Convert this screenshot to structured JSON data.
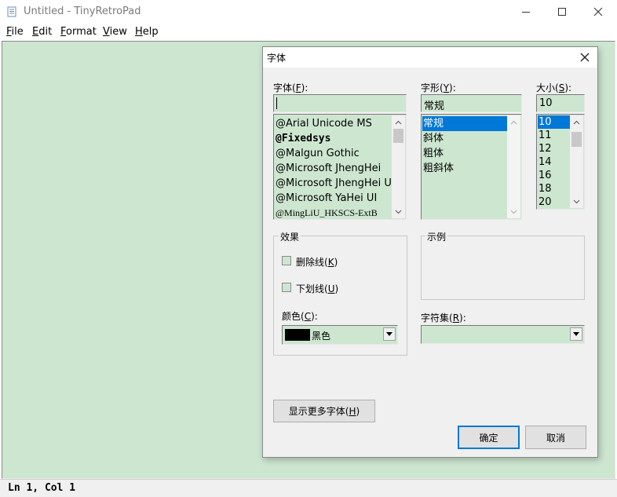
{
  "window": {
    "title": "Untitled - TinyRetroPad",
    "icon": "notepad-icon"
  },
  "menu": [
    {
      "accel": "F",
      "rest": "ile"
    },
    {
      "accel": "E",
      "rest": "dit"
    },
    {
      "accel": "F",
      "rest": "ormat"
    },
    {
      "accel": "V",
      "rest": "iew"
    },
    {
      "accel": "H",
      "rest": "elp"
    }
  ],
  "status": {
    "text": "Ln 1, Col 1"
  },
  "colors": {
    "editor_bg": "#cde6d0",
    "selection": "#0078d7",
    "dialog_bg": "#f0f0f0"
  },
  "dialog": {
    "title": "字体",
    "font": {
      "label_pre": "字体(",
      "label_accel": "F",
      "label_post": "):",
      "value": "",
      "items": [
        "@Arial Unicode MS",
        "@Fixedsys",
        "@Malgun Gothic",
        "@Microsoft JhengHei",
        "@Microsoft JhengHei UI",
        "@Microsoft YaHei UI",
        "@MingLiU_HKSCS-ExtB"
      ]
    },
    "style": {
      "label_pre": "字形(",
      "label_accel": "Y",
      "label_post": "):",
      "value": "常规",
      "items": [
        "常规",
        "斜体",
        "粗体",
        "粗斜体"
      ],
      "selected": 0
    },
    "size": {
      "label_pre": "大小(",
      "label_accel": "S",
      "label_post": "):",
      "value": "10",
      "items": [
        "10",
        "11",
        "12",
        "14",
        "16",
        "18",
        "20"
      ],
      "selected": 0
    },
    "effects": {
      "title": "效果",
      "strike_pre": "删除线(",
      "strike_accel": "K",
      "strike_post": ")",
      "strike_checked": false,
      "underline_pre": "下划线(",
      "underline_accel": "U",
      "underline_post": ")",
      "underline_checked": false,
      "color_label_pre": "颜色(",
      "color_label_accel": "C",
      "color_label_post": "):",
      "color_value": "黑色",
      "color_swatch": "#000000"
    },
    "sample": {
      "title": "示例"
    },
    "charset": {
      "label_pre": "字符集(",
      "label_accel": "R",
      "label_post": "):",
      "value": ""
    },
    "more_fonts": {
      "pre": "显示更多字体(",
      "accel": "H",
      "post": ")"
    },
    "ok_label": "确定",
    "cancel_label": "取消"
  }
}
